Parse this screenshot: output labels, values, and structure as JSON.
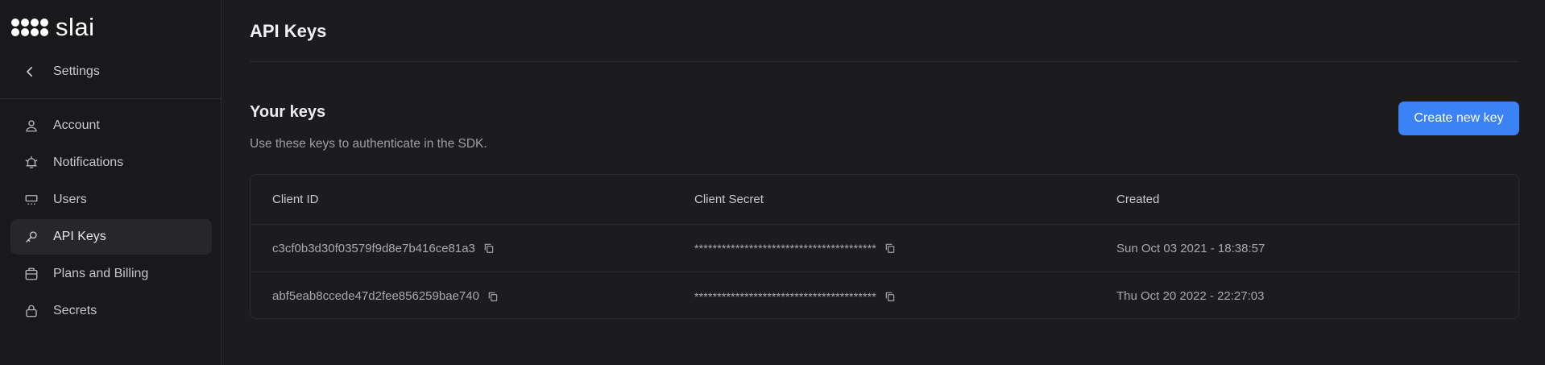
{
  "app": {
    "logo_text": "slai"
  },
  "sidebar": {
    "back_label": "Settings",
    "items": [
      {
        "label": "Account",
        "icon": "user-icon"
      },
      {
        "label": "Notifications",
        "icon": "bell-icon"
      },
      {
        "label": "Users",
        "icon": "users-icon"
      },
      {
        "label": "API Keys",
        "icon": "key-icon",
        "active": true
      },
      {
        "label": "Plans and Billing",
        "icon": "billing-icon"
      },
      {
        "label": "Secrets",
        "icon": "lock-icon"
      }
    ]
  },
  "main": {
    "title": "API Keys",
    "section_title": "Your keys",
    "section_subtitle": "Use these keys to authenticate in the SDK.",
    "create_button": "Create new key",
    "table": {
      "columns": [
        "Client ID",
        "Client Secret",
        "Created"
      ],
      "rows": [
        {
          "client_id": "c3cf0b3d30f03579f9d8e7b416ce81a3",
          "client_secret": "****************************************",
          "created": "Sun Oct 03 2021 - 18:38:57"
        },
        {
          "client_id": "abf5eab8ccede47d2fee856259bae740",
          "client_secret": "****************************************",
          "created": "Thu Oct 20 2022 - 22:27:03"
        }
      ]
    }
  },
  "colors": {
    "accent": "#3b82f6",
    "background": "#1c1c1f",
    "sidebar_bg": "#19191c",
    "active_item_bg": "#27272b"
  }
}
